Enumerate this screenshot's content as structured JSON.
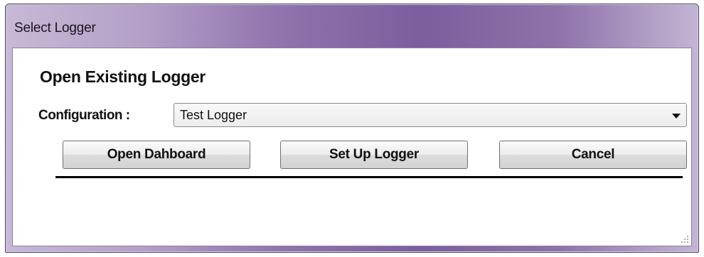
{
  "window": {
    "title": "Select Logger"
  },
  "dialog": {
    "heading": "Open Existing Logger",
    "configuration_label": "Configuration :",
    "configuration_value": "Test Logger"
  },
  "buttons": {
    "open_dashboard": "Open Dahboard",
    "set_up_logger": "Set Up Logger",
    "cancel": "Cancel"
  },
  "icons": {
    "dropdown": "chevron-down-icon",
    "resize": "resize-grip-icon"
  },
  "colors": {
    "titlebar_accent": "#7b5e9c",
    "divider": "#000000"
  }
}
